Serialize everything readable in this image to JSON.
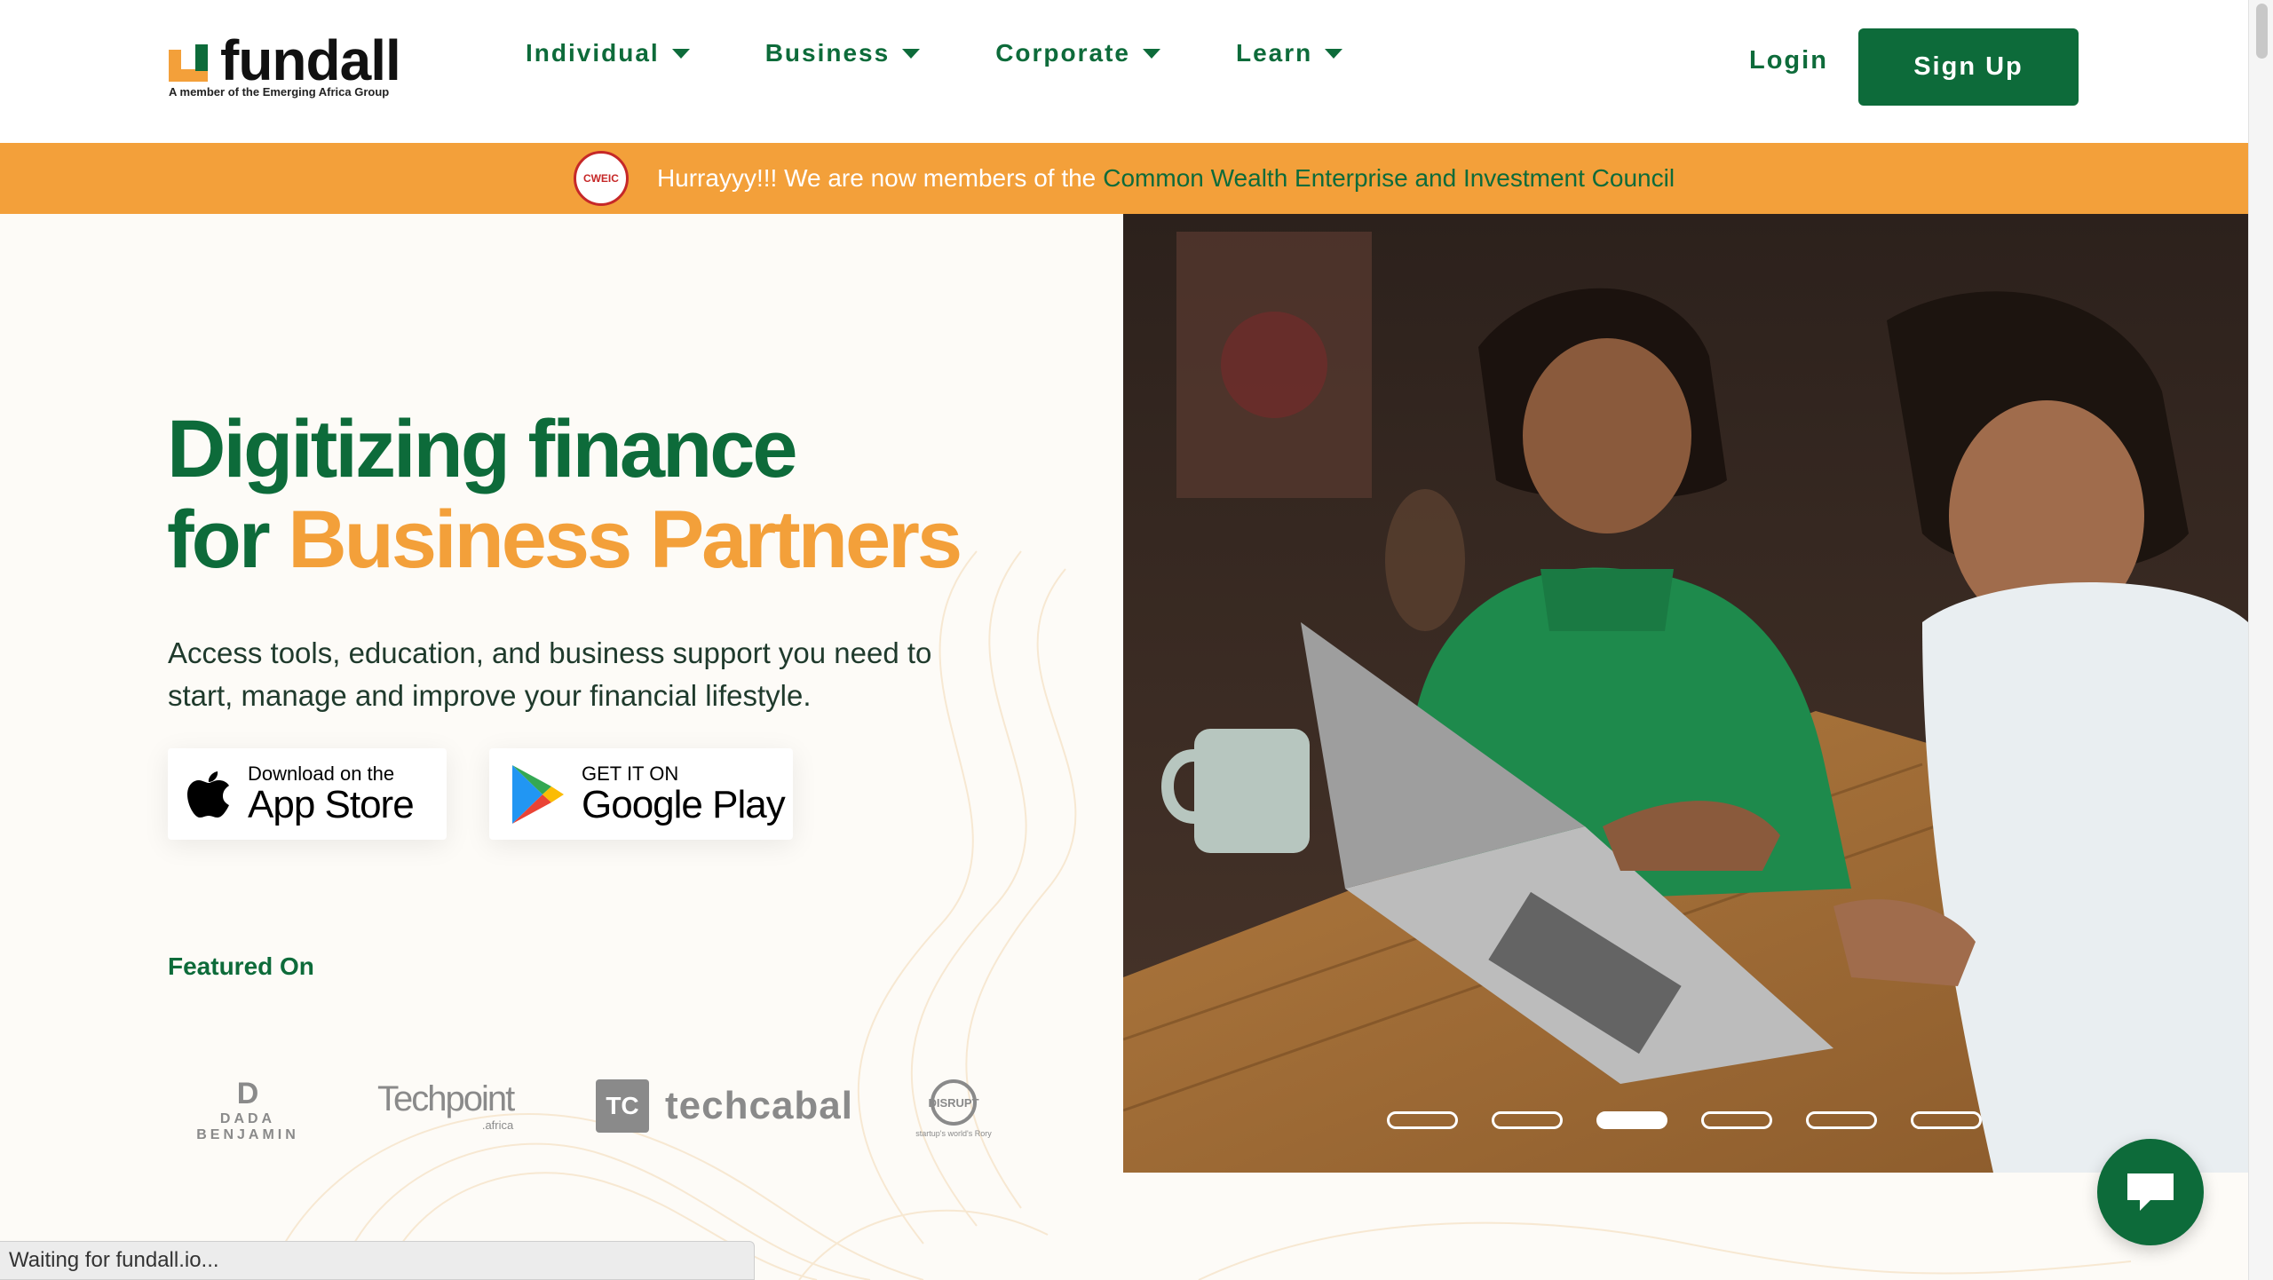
{
  "header": {
    "logo_word": "fundall",
    "logo_tagline": "A member of the Emerging Africa Group",
    "nav": [
      {
        "label": "Individual"
      },
      {
        "label": "Business"
      },
      {
        "label": "Corporate"
      },
      {
        "label": "Learn"
      }
    ],
    "login_label": "Login",
    "signup_label": "Sign Up"
  },
  "banner": {
    "badge": "CWEIC",
    "text": "Hurrayyy!!! We are now members of the",
    "link": "Common Wealth Enterprise and Investment Council"
  },
  "hero": {
    "title_line1": "Digitizing finance",
    "title_for": "for ",
    "title_highlight": "Business Partners",
    "subtitle": "Access tools, education, and business support you need to start, manage and improve your financial lifestyle.",
    "app_store": {
      "small": "Download on the",
      "big": "App Store"
    },
    "google_play": {
      "small": "GET IT ON",
      "big": "Google Play"
    },
    "featured_label": "Featured On",
    "featured_logos": {
      "dada_mark": "D",
      "dada_text": "DADA BENJAMIN",
      "techpoint": "Techpoint",
      "techpoint_sub": ".africa",
      "techcabal_box": "TC",
      "techcabal": "techcabal",
      "disrupt": "DISRUPT",
      "disrupt_sub": "startup's world's Rory"
    }
  },
  "carousel": {
    "slide_count": 6,
    "active_index": 2
  },
  "status_text": "Waiting for fundall.io...",
  "colors": {
    "brand_green": "#0d6b3a",
    "brand_orange": "#f3a03a",
    "background": "#fdfbf7"
  }
}
